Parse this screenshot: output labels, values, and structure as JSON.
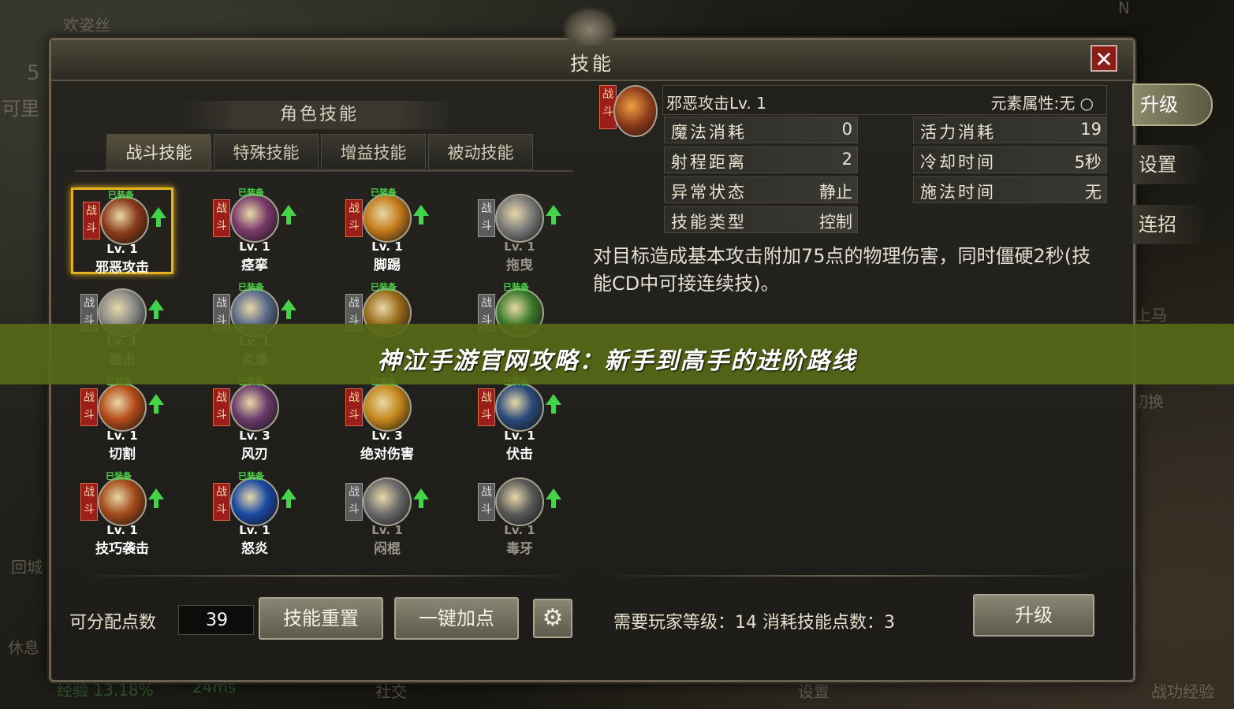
{
  "background": {
    "top_left_name": "欢姿丝",
    "left_fragment": "可里",
    "left_number": "5",
    "left_back": "回城",
    "left_rest": "休息",
    "bottom_left_exp": "经验 13.18%",
    "bottom_ping": "24ms",
    "bottom_social": "社交",
    "bottom_settings": "设置",
    "bottom_right": "战功经验",
    "compass": "N",
    "ride": "上马",
    "switch": "切换"
  },
  "panel": {
    "title": "技能",
    "close_label": "✕"
  },
  "skills_section": {
    "title": "角色技能",
    "tabs": [
      {
        "label": "战斗技能",
        "active": true
      },
      {
        "label": "特殊技能",
        "active": false
      },
      {
        "label": "增益技能",
        "active": false
      },
      {
        "label": "被动技能",
        "active": false
      }
    ],
    "badge_text": "战斗",
    "equipped_text": "已装备",
    "skills": [
      {
        "level": "Lv. 1",
        "name": "邪恶攻击",
        "equipped": true,
        "upgrade": true,
        "active": true,
        "color": "#8a3a1a"
      },
      {
        "level": "Lv. 1",
        "name": "痉挛",
        "equipped": true,
        "upgrade": true,
        "active": true,
        "color": "#7a3a6a"
      },
      {
        "level": "Lv. 1",
        "name": "脚踢",
        "equipped": true,
        "upgrade": true,
        "active": true,
        "color": "#c47a1a"
      },
      {
        "level": "Lv. 1",
        "name": "拖曳",
        "equipped": false,
        "upgrade": true,
        "active": false,
        "color": "#7a7a7a"
      },
      {
        "level": "Lv. 1",
        "name": "凿击",
        "equipped": false,
        "upgrade": true,
        "active": false,
        "color": "#8a8a8a"
      },
      {
        "level": "Lv. 1",
        "name": "炎爆",
        "equipped": true,
        "upgrade": true,
        "active": false,
        "color": "#5a6a8a"
      },
      {
        "level": "",
        "name": "",
        "equipped": true,
        "upgrade": false,
        "active": false,
        "color": "#9a6a1a"
      },
      {
        "level": "",
        "name": "",
        "equipped": true,
        "upgrade": false,
        "active": false,
        "color": "#3a7a2a"
      },
      {
        "level": "Lv. 1",
        "name": "切割",
        "equipped": true,
        "upgrade": true,
        "active": true,
        "color": "#b44a1a"
      },
      {
        "level": "Lv. 3",
        "name": "风刃",
        "equipped": true,
        "upgrade": false,
        "active": true,
        "color": "#6a3a6a"
      },
      {
        "level": "Lv. 3",
        "name": "绝对伤害",
        "equipped": true,
        "upgrade": false,
        "active": true,
        "color": "#c4861a"
      },
      {
        "level": "Lv. 1",
        "name": "伏击",
        "equipped": true,
        "upgrade": true,
        "active": true,
        "color": "#2a4a7a"
      },
      {
        "level": "Lv. 1",
        "name": "技巧袭击",
        "equipped": true,
        "upgrade": true,
        "active": true,
        "color": "#a44a1a"
      },
      {
        "level": "Lv. 1",
        "name": "怒炎",
        "equipped": true,
        "upgrade": true,
        "active": true,
        "color": "#1a4aa4"
      },
      {
        "level": "Lv. 1",
        "name": "闷棍",
        "equipped": false,
        "upgrade": true,
        "active": false,
        "color": "#6a6a6a"
      },
      {
        "level": "Lv. 1",
        "name": "毒牙",
        "equipped": false,
        "upgrade": true,
        "active": false,
        "color": "#5a5a5a"
      }
    ]
  },
  "detail": {
    "skill_title": "邪恶攻击Lv. 1",
    "element": "元素属性:无 ○",
    "rows_left": [
      {
        "key": "魔法消耗",
        "value": "0"
      },
      {
        "key": "射程距离",
        "value": "2"
      },
      {
        "key": "异常状态",
        "value": "静止"
      },
      {
        "key": "技能类型",
        "value": "控制"
      }
    ],
    "rows_right": [
      {
        "key": "活力消耗",
        "value": "19"
      },
      {
        "key": "冷却时间",
        "value": "5秒"
      },
      {
        "key": "施法时间",
        "value": "无"
      }
    ],
    "description": "对目标造成基本攻击附加75点的物理伤害，同时僵硬2秒(技能CD中可接连续技)。"
  },
  "bottom": {
    "points_label": "可分配点数",
    "points_value": "39",
    "reset_label": "技能重置",
    "auto_label": "一键加点",
    "requirement": "需要玩家等级：14 消耗技能点数：3",
    "upgrade_label": "升级"
  },
  "side_menu": {
    "upgrade": "升级",
    "settings": "设置",
    "combo": "连招"
  },
  "banner": {
    "text": "神泣手游官网攻略：新手到高手的进阶路线"
  }
}
